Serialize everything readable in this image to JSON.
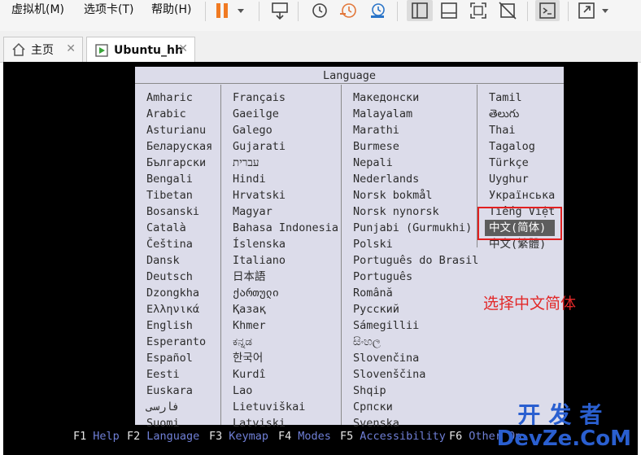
{
  "menu": {
    "items": [
      "虚拟机(M)",
      "选项卡(T)",
      "帮助(H)"
    ]
  },
  "tabs": [
    {
      "label": "主页"
    },
    {
      "label": "Ubuntu_hh"
    }
  ],
  "installer": {
    "title": "Language",
    "columns": [
      [
        "Amharic",
        "Arabic",
        "Asturianu",
        "Беларуская",
        "Български",
        "Bengali",
        "Tibetan",
        "Bosanski",
        "Català",
        "Čeština",
        "Dansk",
        "Deutsch",
        "Dzongkha",
        "Ελληνικά",
        "English",
        "Esperanto",
        "Español",
        "Eesti",
        "Euskara",
        "فارسی",
        "Suomi"
      ],
      [
        "Français",
        "Gaeilge",
        "Galego",
        "Gujarati",
        "עברית",
        "Hindi",
        "Hrvatski",
        "Magyar",
        "Bahasa Indonesia",
        "Íslenska",
        "Italiano",
        "日本語",
        "ქართული",
        "Қазақ",
        "Khmer",
        "ಕನ್ನಡ",
        "한국어",
        "Kurdî",
        "Lao",
        "Lietuviškai",
        "Latviski"
      ],
      [
        "Македонски",
        "Malayalam",
        "Marathi",
        "Burmese",
        "Nepali",
        "Nederlands",
        "Norsk bokmål",
        "Norsk nynorsk",
        "Punjabi (Gurmukhi)",
        "Polski",
        "Português do Brasil",
        "Português",
        "Română",
        "Русский",
        "Sámegillii",
        "සිංහල",
        "Slovenčina",
        "Slovenščina",
        "Shqip",
        "Српски",
        "Svenska"
      ],
      [
        "Tamil",
        "తెలుగు",
        "Thai",
        "Tagalog",
        "Türkçe",
        "Uyghur",
        "Українська",
        "Tiếng Việt",
        "中文(简体)",
        "中文(繁體)"
      ]
    ],
    "selected": "中文(简体)",
    "function_keys": [
      {
        "key": "F1",
        "label": "Help"
      },
      {
        "key": "F2",
        "label": "Language"
      },
      {
        "key": "F3",
        "label": "Keymap"
      },
      {
        "key": "F4",
        "label": "Modes"
      },
      {
        "key": "F5",
        "label": "Accessibility"
      },
      {
        "key": "F6",
        "label": "Other Op"
      }
    ]
  },
  "annotation": {
    "text": "选择中文简体",
    "color": "#e22828"
  },
  "watermark": {
    "line1": "开发者",
    "line2": "DevZe.CoM"
  }
}
